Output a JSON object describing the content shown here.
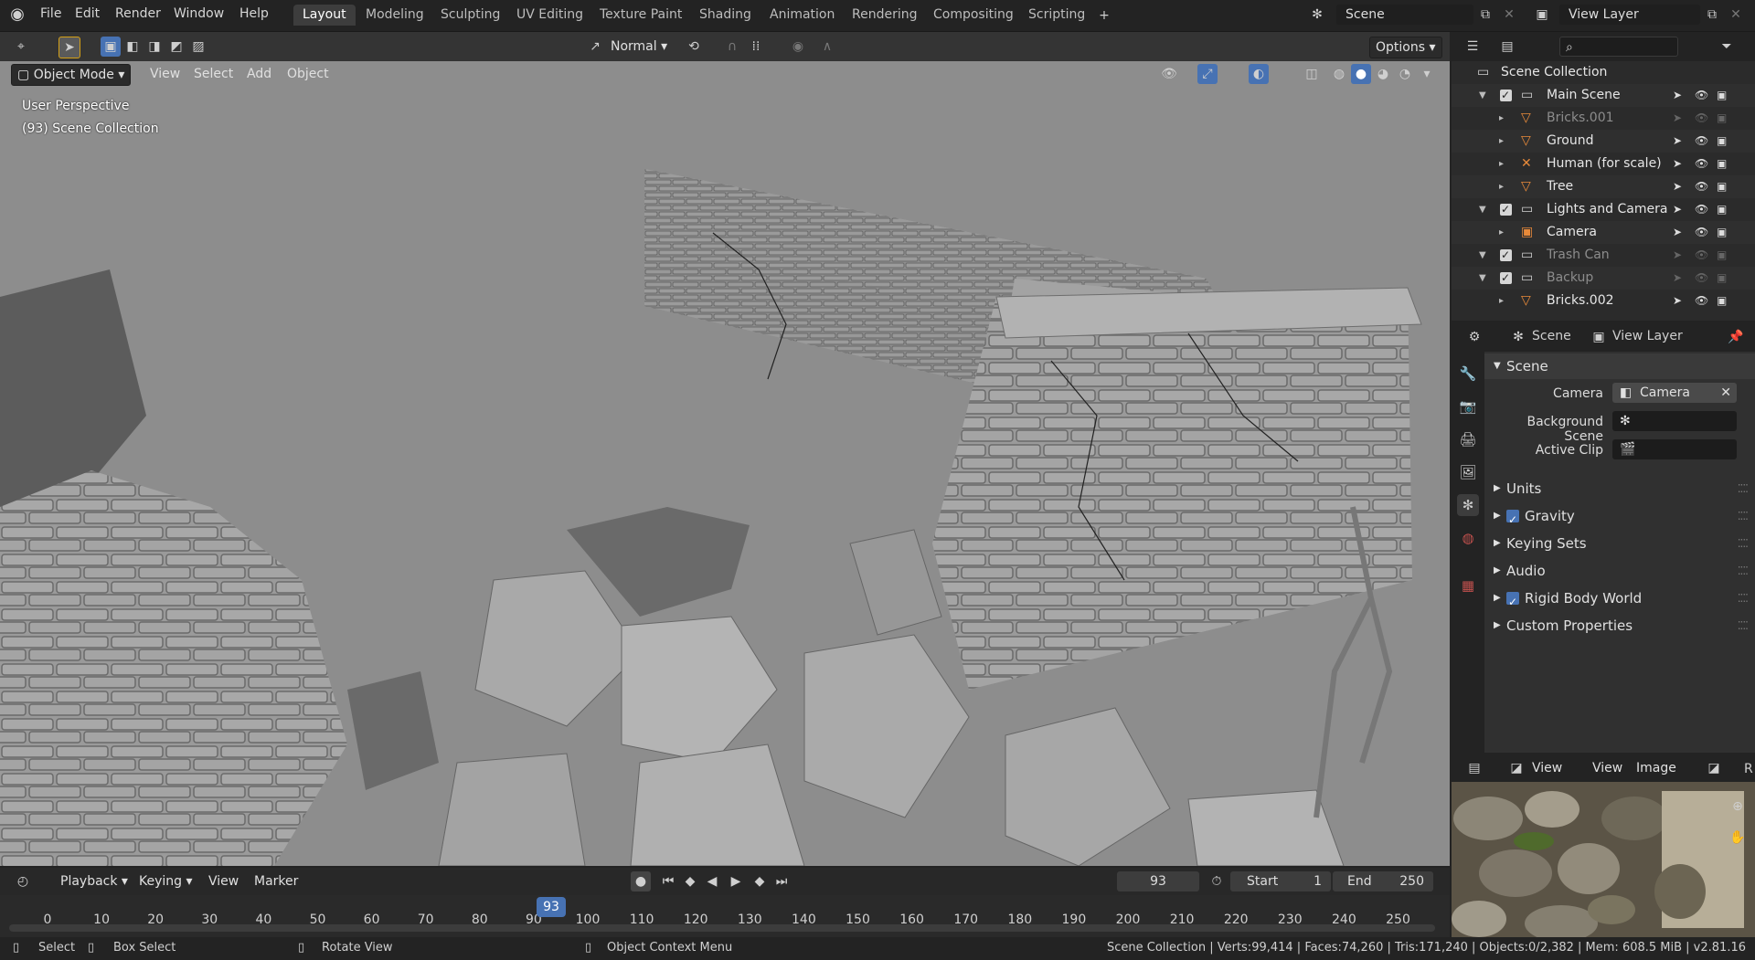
{
  "topbar": {
    "menus": [
      "File",
      "Edit",
      "Render",
      "Window",
      "Help"
    ],
    "workspace_tabs": [
      "Layout",
      "Modeling",
      "Sculpting",
      "UV Editing",
      "Texture Paint",
      "Shading",
      "Animation",
      "Rendering",
      "Compositing",
      "Scripting"
    ],
    "active_tab": "Layout",
    "add_tab_icon": "+",
    "scene_name": "Scene",
    "view_layer_name": "View Layer"
  },
  "viewport": {
    "transform_orientation": "Normal",
    "options_label": "Options",
    "mode": "Object Mode",
    "menus": [
      "View",
      "Select",
      "Add",
      "Object"
    ],
    "perspective_text": "User Perspective",
    "collection_text": "(93) Scene Collection",
    "background_color": "#8a8a8a"
  },
  "outliner": {
    "search_placeholder": "",
    "root": "Scene Collection",
    "rows": [
      {
        "label": "Main Scene",
        "type": "collection",
        "dim": false,
        "checked": true
      },
      {
        "label": "Bricks.001",
        "type": "mesh",
        "dim": true
      },
      {
        "label": "Ground",
        "type": "mesh",
        "dim": false
      },
      {
        "label": "Human (for scale)",
        "type": "armature",
        "dim": false
      },
      {
        "label": "Tree",
        "type": "mesh",
        "dim": false
      },
      {
        "label": "Lights and Camera",
        "type": "collection",
        "dim": false,
        "checked": true
      },
      {
        "label": "Camera",
        "type": "camera",
        "dim": false
      },
      {
        "label": "Trash Can",
        "type": "collection",
        "dim": true,
        "checked": true
      },
      {
        "label": "Backup",
        "type": "collection",
        "dim": true,
        "checked": true
      },
      {
        "label": "Bricks.002",
        "type": "mesh",
        "dim": false
      }
    ]
  },
  "properties": {
    "breadcrumb_scene": "Scene",
    "breadcrumb_view_layer": "View Layer",
    "panel_title": "Scene",
    "camera_label": "Camera",
    "camera_value": "Camera",
    "background_scene_label": "Background Scene",
    "active_clip_label": "Active Clip",
    "subpanels": [
      {
        "label": "Units",
        "checkbox": false
      },
      {
        "label": "Gravity",
        "checkbox": true
      },
      {
        "label": "Keying Sets",
        "checkbox": false
      },
      {
        "label": "Audio",
        "checkbox": false
      },
      {
        "label": "Rigid Body World",
        "checkbox": true
      },
      {
        "label": "Custom Properties",
        "checkbox": false
      }
    ]
  },
  "image_editor": {
    "menus": [
      "View",
      "View",
      "Image"
    ],
    "extra": "R"
  },
  "timeline": {
    "menus": [
      "Playback",
      "Keying",
      "View",
      "Marker"
    ],
    "current_frame": "93",
    "start_label": "Start",
    "start_value": "1",
    "end_label": "End",
    "end_value": "250",
    "ruler": [
      "0",
      "10",
      "20",
      "30",
      "40",
      "50",
      "60",
      "70",
      "80",
      "90",
      "100",
      "110",
      "120",
      "130",
      "140",
      "150",
      "160",
      "170",
      "180",
      "190",
      "200",
      "210",
      "220",
      "230",
      "240",
      "250"
    ],
    "playhead": "93"
  },
  "statusbar": {
    "select": "Select",
    "box_select": "Box Select",
    "rotate_view": "Rotate View",
    "context_menu": "Object Context Menu",
    "stats": "Scene Collection | Verts:99,414 | Faces:74,260 | Tris:171,240 | Objects:0/2,382 | Mem: 608.5 MiB | v2.81.16"
  }
}
